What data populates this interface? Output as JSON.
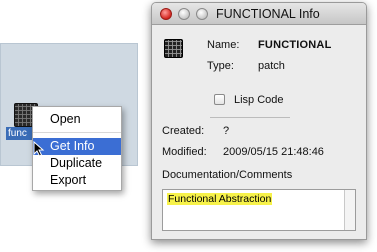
{
  "desktop_item": {
    "file_label": "func",
    "icon": "patch-icon"
  },
  "context_menu": {
    "items": [
      {
        "label": "Open",
        "selected": false
      },
      {
        "label": "Get Info",
        "selected": true
      },
      {
        "label": "Duplicate",
        "selected": false
      },
      {
        "label": "Export",
        "selected": false
      }
    ]
  },
  "info_window": {
    "title": "FUNCTIONAL Info",
    "name_label": "Name:",
    "name_value": "FUNCTIONAL",
    "type_label": "Type:",
    "type_value": "patch",
    "lisp_code_label": "Lisp Code",
    "lisp_code_checked": false,
    "created_label": "Created:",
    "created_value": "?",
    "modified_label": "Modified:",
    "modified_value": "2009/05/15 21:48:46",
    "doc_label": "Documentation/Comments",
    "doc_text": "Functional Abstraction"
  },
  "colors": {
    "menu_highlight": "#3b6ed4",
    "doc_highlight": "#f7f24a",
    "panel_bg": "#cfd9e2"
  }
}
